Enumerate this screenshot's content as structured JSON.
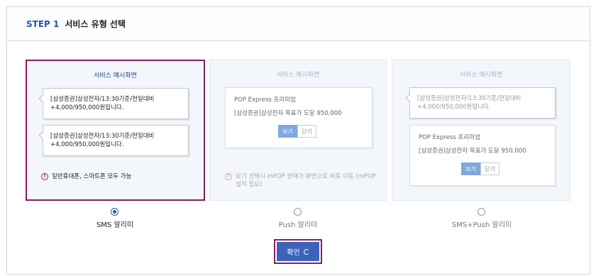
{
  "header": {
    "step": "STEP 1",
    "title": "서비스 유형 선택"
  },
  "cards": [
    {
      "title": "서비스 예시화면",
      "bubble1": "[삼성증권]삼성전자/13:30기준/전일대비 +4,000/950,000원입니다.",
      "bubble2": "[삼성증권]삼성전자/13:30기준/전일대비 +4,000/950,000원입니다.",
      "note": "일반휴대폰, 스마트폰 모두 가능"
    },
    {
      "title": "서비스 예시화면",
      "push_title": "POP Express 프리미엄",
      "push_body": "[삼성증권]삼성전자 목표가 도달 950,000",
      "view_label": "보기",
      "close_label": "닫기",
      "note": "보기 선택시 mPOP 현재가 화면으로 바로 이동 (mPOP 설치 필요)"
    },
    {
      "title": "서비스 예시화면",
      "bubble1": "[삼성증권]삼성전자/13:30기준/전일대비 +4,000/950,000원입니다.",
      "push_title": "POP Express 프리미엄",
      "push_body": "[삼성증권]삼성전자 목표가 도달 950,000",
      "view_label": "보기",
      "close_label": "닫기"
    }
  ],
  "options": [
    {
      "label": "SMS 알리미",
      "checked": true
    },
    {
      "label": "Push 알리미",
      "checked": false
    },
    {
      "label": "SMS+Push 알리미",
      "checked": false
    }
  ],
  "confirm_label": "확인",
  "colors": {
    "accent": "#1e5aa8",
    "highlight": "#8b1d62",
    "button": "#3b63b8"
  }
}
